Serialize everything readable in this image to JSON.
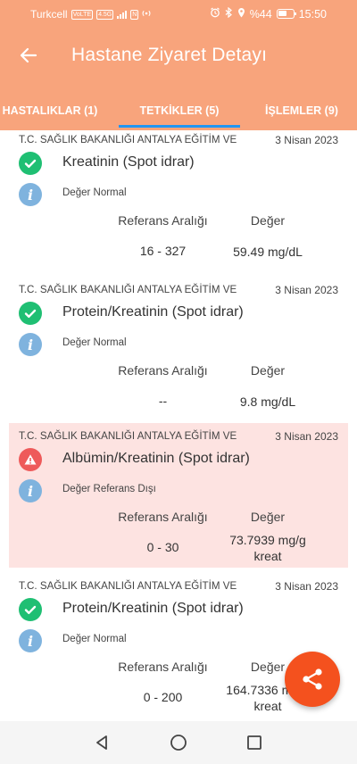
{
  "status_bar": {
    "carrier": "Turkcell",
    "volte": "VoLTE",
    "network": "4.5G",
    "nfc": "N",
    "battery_percent": "%44",
    "time": "15:50"
  },
  "header": {
    "title": "Hastane Ziyaret Detayı",
    "back_icon": "arrow-left-icon"
  },
  "tabs": [
    {
      "label": "HASTALIKLAR (1)",
      "active": false
    },
    {
      "label": "TETKİKLER (5)",
      "active": true
    },
    {
      "label": "İŞLEMLER (9)",
      "active": false
    }
  ],
  "colors": {
    "header_bg": "#F8A47C",
    "tab_indicator": "#2196F3",
    "ok_icon": "#1FBF73",
    "warn_icon": "#EE5A5A",
    "info_icon": "#7FB3DE",
    "alert_card_bg": "#FDE3E1",
    "fab_bg": "#F4511E"
  },
  "labels": {
    "reference_range": "Referans Aralığı",
    "value": "Değer"
  },
  "results": [
    {
      "hospital": "T.C. SAĞLIK BAKANLIĞI ANTALYA EĞİTİM VE",
      "date": "3 Nisan 2023",
      "test": "Kreatinin (Spot idrar)",
      "status": "normal",
      "status_text": "Değer Normal",
      "reference_range": "16 - 327",
      "value": "59.49 mg/dL"
    },
    {
      "hospital": "T.C. SAĞLIK BAKANLIĞI ANTALYA EĞİTİM VE",
      "date": "3 Nisan 2023",
      "test": "Protein/Kreatinin (Spot idrar)",
      "status": "normal",
      "status_text": "Değer Normal",
      "reference_range": "--",
      "value": "9.8 mg/dL"
    },
    {
      "hospital": "T.C. SAĞLIK BAKANLIĞI ANTALYA EĞİTİM VE",
      "date": "3 Nisan 2023",
      "test": "Albümin/Kreatinin (Spot idrar)",
      "status": "out_of_range",
      "status_text": "Değer Referans Dışı",
      "reference_range": "0 - 30",
      "value": "73.7939 mg/g kreat"
    },
    {
      "hospital": "T.C. SAĞLIK BAKANLIĞI ANTALYA EĞİTİM VE",
      "date": "3 Nisan 2023",
      "test": "Protein/Kreatinin (Spot idrar)",
      "status": "normal",
      "status_text": "Değer Normal",
      "reference_range": "0 - 200",
      "value": "164.7336 mg/g kreat"
    }
  ],
  "fab": {
    "icon": "share-icon"
  },
  "nav_bar": {
    "icons": [
      "back-triangle-icon",
      "home-circle-icon",
      "recents-square-icon"
    ]
  }
}
